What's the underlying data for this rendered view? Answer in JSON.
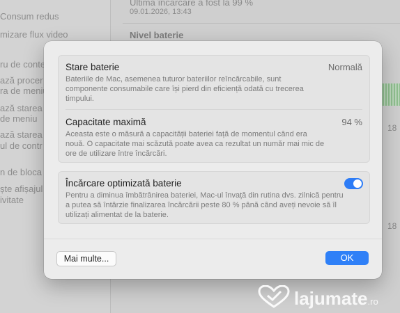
{
  "background": {
    "sidebar_items": [
      "Consum redus",
      "mizare flux video",
      "ru de conte",
      "ază procer",
      "ra de meniu",
      "ază starea",
      "de meniu",
      "ază starea",
      "ul de contr",
      "n de bloca",
      "ște afișajul",
      "ivitate"
    ],
    "last_charge_text": "Ultima încărcare a fost la 99 %",
    "last_charge_date": "09.01.2026, 13:43",
    "section_title": "Nivel baterie",
    "right_labels": [
      "18",
      "18"
    ]
  },
  "dialog": {
    "battery_state": {
      "title": "Stare baterie",
      "value": "Normală",
      "description": "Bateriile de Mac, asemenea tuturor bateriilor reîncărcabile, sunt componente consumabile care își pierd din eficiență odată cu trecerea timpului."
    },
    "max_capacity": {
      "title": "Capacitate maximă",
      "value": "94 %",
      "description": "Aceasta este o măsură a capacității bateriei față de momentul când era nouă. O capacitate mai scăzută poate avea ca rezultat un număr mai mic de ore de utilizare între încărcări."
    },
    "optimized_charging": {
      "title": "Încărcare optimizată baterie",
      "enabled": true,
      "description": "Pentru a diminua îmbătrânirea bateriei, Mac-ul învață din rutina dvs. zilnică pentru a putea să întârzie finalizarea încărcării peste 80 % până când aveți nevoie să îl utilizați alimentat de la baterie."
    },
    "more_button": "Mai multe...",
    "ok_button": "OK"
  },
  "watermark": {
    "text": "lajumate",
    "suffix": ".ro"
  },
  "colors": {
    "accent": "#2f80f7",
    "dialog_bg": "#ececec",
    "card_bg": "#e4e4e4"
  }
}
